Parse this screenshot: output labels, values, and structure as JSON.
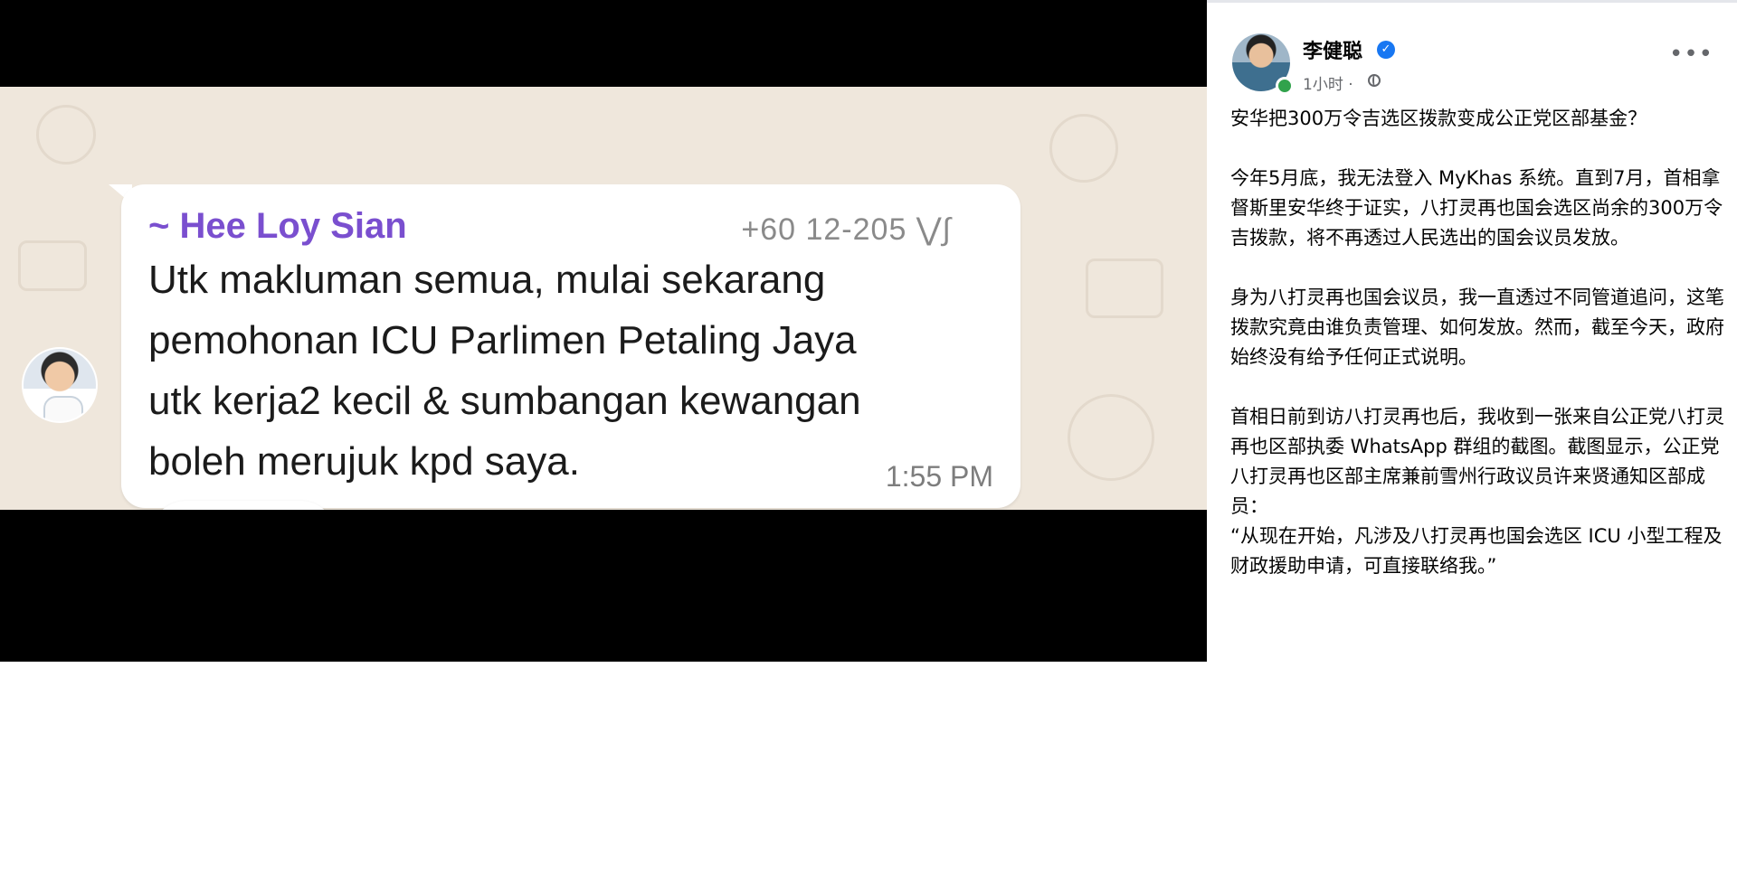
{
  "whatsapp": {
    "sender_name": "~ Hee Loy Sian",
    "phone": "+60 12-205 ⋁∫",
    "message": "Utk makluman semua, mulai sekarang\npemohonan ICU Parlimen Petaling Jaya\nutk kerja2 kecil & sumbangan kewangan\nboleh merujuk kpd saya.",
    "time": "1:55 PM",
    "reactions": {
      "emoji_1": "👍",
      "emoji_2": "🙆",
      "count": "0"
    }
  },
  "post": {
    "author": "李健聪",
    "verified_icon": "verified-badge-icon",
    "time": "1小时 ·",
    "privacy_icon": "globe-icon",
    "more_label": "•••",
    "paragraphs": [
      "安华把300万令吉选区拨款变成公正党区部基金？",
      "今年5月底，我无法登入 MyKhas 系统。直到7月，首相拿督斯里安华终于证实，八打灵再也国会选区尚余的300万令吉拨款，将不再透过人民选出的国会议员发放。",
      "身为八打灵再也国会议员，我一直透过不同管道追问，这笔拨款究竟由谁负责管理、如何发放。然而，截至今天，政府始终没有给予任何正式说明。",
      "首相日前到访八打灵再也后，我收到一张来自公正党八打灵再也区部执委 WhatsApp 群组的截图。截图显示，公正党八打灵再也区部主席兼前雪州行政议员许来贤通知区部成员："
    ],
    "quote": "“从现在开始，凡涉及八打灵再也国会选区 ICU 小型工程及财政援助申请，可直接联络我。”"
  },
  "colors": {
    "sender": "#7a4fcf",
    "chat_bg": "#efe7dc",
    "verified": "#1877f2",
    "online": "#31a24c"
  }
}
